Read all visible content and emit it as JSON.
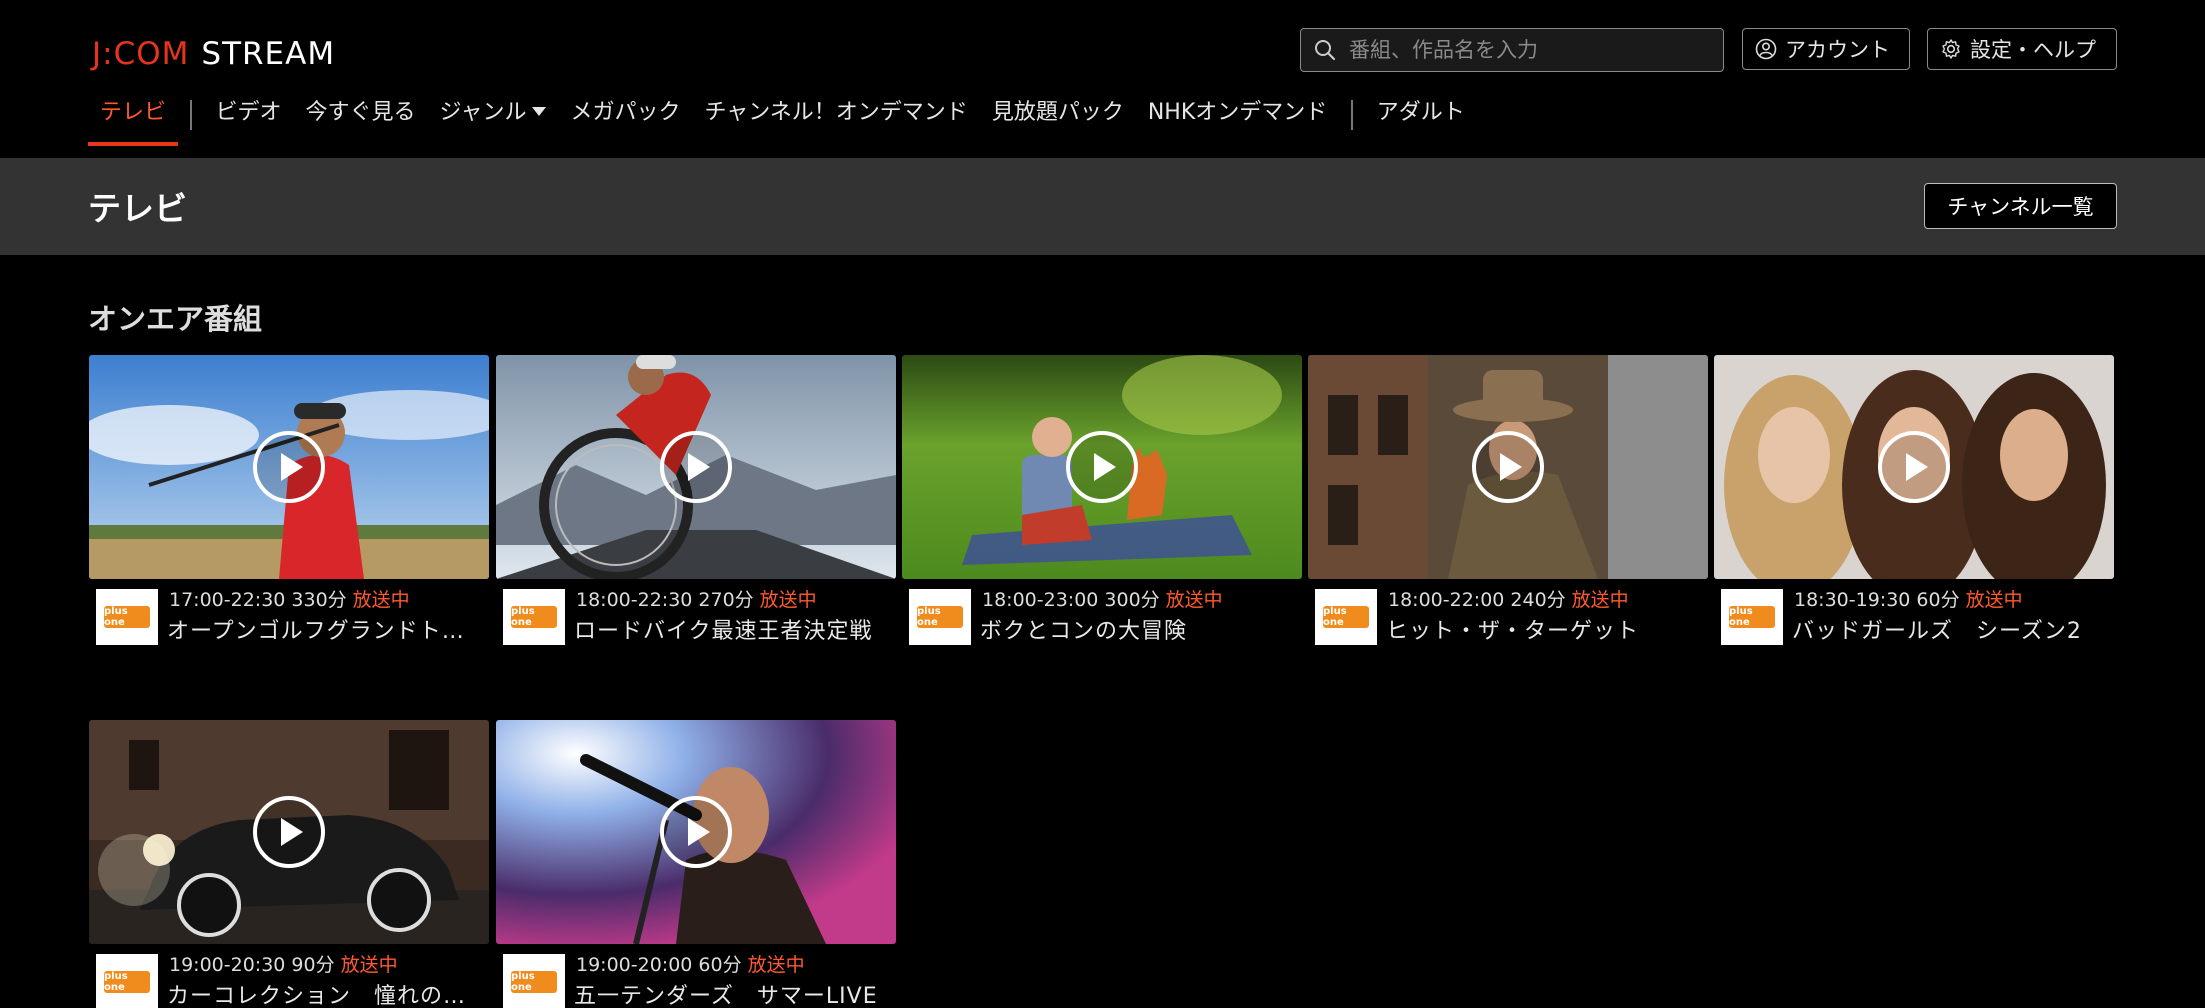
{
  "brand": {
    "part1": "J:COM",
    "part2": "STREAM"
  },
  "search": {
    "placeholder": "番組、作品名を入力"
  },
  "header_buttons": {
    "account": "アカウント",
    "settings": "設定・ヘルプ"
  },
  "nav": {
    "items": [
      {
        "label": "テレビ"
      },
      {
        "label": "ビデオ"
      },
      {
        "label": "今すぐ見る"
      },
      {
        "label": "ジャンル"
      },
      {
        "label": "メガパック"
      },
      {
        "label": "チャンネル！オンデマンド"
      },
      {
        "label": "見放題パック"
      },
      {
        "label": "NHKオンデマンド"
      },
      {
        "label": "アダルト"
      }
    ]
  },
  "page": {
    "title": "テレビ",
    "channel_list_button": "チャンネル一覧"
  },
  "section": {
    "title": "オンエア番組"
  },
  "channel_logo_text": "plus one",
  "programs": [
    {
      "time": "17:00-22:30 330分",
      "status": "放送中",
      "title": "オープンゴルフグランドトーナメント"
    },
    {
      "time": "18:00-22:30 270分",
      "status": "放送中",
      "title": "ロードバイク最速王者決定戦"
    },
    {
      "time": "18:00-23:00 300分",
      "status": "放送中",
      "title": "ボクとコンの大冒険"
    },
    {
      "time": "18:00-22:00 240分",
      "status": "放送中",
      "title": "ヒット・ザ・ターゲット"
    },
    {
      "time": "18:30-19:30 60分",
      "status": "放送中",
      "title": "バッドガールズ　シーズン2"
    },
    {
      "time": "19:00-20:30 90分",
      "status": "放送中",
      "title": "カーコレクション　憧れの名車たち"
    },
    {
      "time": "19:00-20:00 60分",
      "status": "放送中",
      "title": "五一テンダーズ　サマーLIVE"
    }
  ],
  "colors": {
    "accent": "#e8341c",
    "onair": "#ff5a2e",
    "titlebar": "#333333",
    "background": "#000000"
  }
}
